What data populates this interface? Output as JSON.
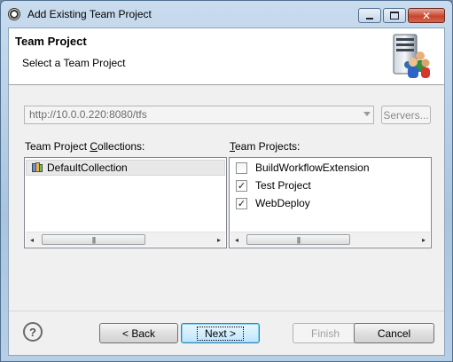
{
  "window": {
    "title": "Add Existing Team Project"
  },
  "header": {
    "title": "Team Project",
    "subtitle": "Select a Team Project"
  },
  "server": {
    "url": "http://10.0.0.220:8080/tfs",
    "servers_button": "Servers..."
  },
  "collections": {
    "label": "Team Project Collections:",
    "label_mnemonic": "C",
    "items": [
      {
        "label": "DefaultCollection",
        "selected": true
      }
    ]
  },
  "projects": {
    "label": "Team Projects:",
    "label_mnemonic": "T",
    "items": [
      {
        "label": "BuildWorkflowExtension",
        "checked": false
      },
      {
        "label": "Test Project",
        "checked": true
      },
      {
        "label": "WebDeploy",
        "checked": true
      }
    ]
  },
  "buttons": {
    "back": "< Back",
    "next": "Next >",
    "finish": "Finish",
    "cancel": "Cancel",
    "help": "?"
  },
  "scrollbar": {
    "left_arrow": "◂",
    "right_arrow": "▸",
    "thumb_grip": "|||"
  },
  "titlebar": {
    "close": "✕"
  },
  "colors": {
    "accent": "#3c7fb1",
    "selection": "#e8e8e8"
  }
}
